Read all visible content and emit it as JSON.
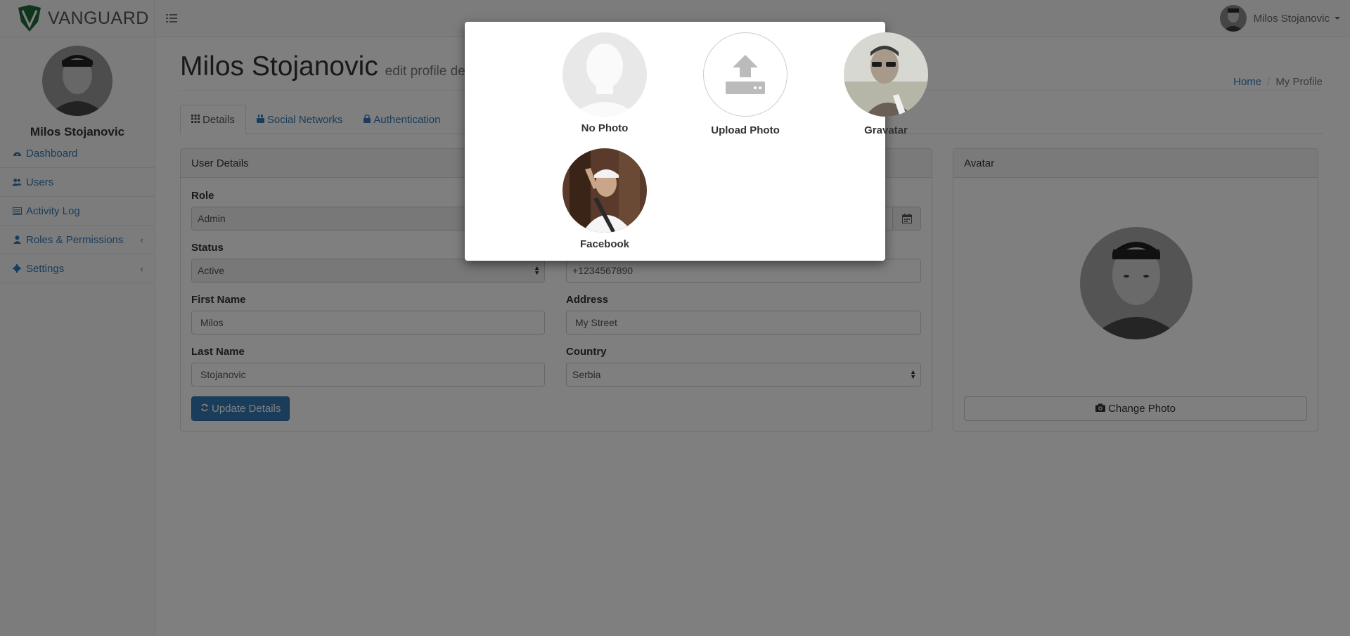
{
  "navbar": {
    "brand": "VANGUARD",
    "toggle_icon": "sidebar-toggle-icon",
    "user_name": "Milos Stojanovic"
  },
  "sidebar": {
    "profile_name": "Milos Stojanovic",
    "items": [
      {
        "label": "Dashboard",
        "icon": "dashboard-icon"
      },
      {
        "label": "Users",
        "icon": "users-icon"
      },
      {
        "label": "Activity Log",
        "icon": "list-icon"
      },
      {
        "label": "Roles & Permissions",
        "icon": "user-icon"
      },
      {
        "label": "Settings",
        "icon": "gear-icon"
      }
    ]
  },
  "header": {
    "title": "Milos Stojanovic",
    "subtitle": "edit profile deta",
    "breadcrumb": {
      "home": "Home",
      "current": "My Profile"
    }
  },
  "tabs": [
    {
      "label": "Details",
      "icon": "grid-icon"
    },
    {
      "label": "Social Networks",
      "icon": "youtube-icon"
    },
    {
      "label": "Authentication",
      "icon": "lock-icon"
    }
  ],
  "details": {
    "heading": "User Details",
    "role_label": "Role",
    "role_value": "Admin",
    "status_label": "Status",
    "status_value": "Active",
    "first_name_label": "First Name",
    "first_name_value": "Milos",
    "last_name_label": "Last Name",
    "last_name_value": "Stojanovic",
    "phone_value": "+1234567890",
    "address_label": "Address",
    "address_value": "My Street",
    "country_label": "Country",
    "country_value": "Serbia",
    "update_button": "Update Details"
  },
  "avatar_panel": {
    "heading": "Avatar",
    "change_button": "Change Photo"
  },
  "modal": {
    "options": [
      {
        "label": "No Photo"
      },
      {
        "label": "Upload Photo"
      },
      {
        "label": "Gravatar"
      },
      {
        "label": "Facebook"
      }
    ]
  },
  "colors": {
    "accent": "#337ab7",
    "brand_green": "#1e6b3a",
    "overlay": "rgba(0,0,0,0.5)"
  }
}
